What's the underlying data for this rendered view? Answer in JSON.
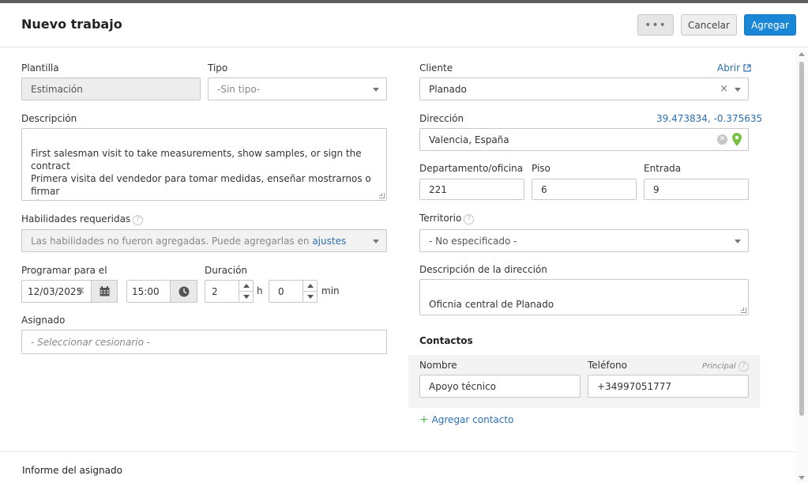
{
  "header": {
    "title": "Nuevo trabajo",
    "more_label": "•••",
    "cancel_label": "Cancelar",
    "add_label": "Agregar"
  },
  "left": {
    "plantilla_label": "Plantilla",
    "plantilla_value": "Estimación",
    "tipo_label": "Tipo",
    "tipo_placeholder": "-Sin tipo-",
    "descripcion_label": "Descripción",
    "descripcion_value": "First salesman visit to take measurements, show samples, or sign the contract\nPrimera visita del vendedor para tomar medidas, enseñar mostrarnos o firmar\nel contrato",
    "habilidades_label": "Habilidades requeridas",
    "habilidades_text": "Las habilidades no fueron agregadas. Puede agregarlas en",
    "habilidades_link": "ajustes",
    "programar_label": "Programar para el",
    "date_value": "12/03/2025",
    "time_value": "15:00",
    "duracion_label": "Duración",
    "hours_value": "2",
    "hours_unit": "h",
    "minutes_value": "0",
    "minutes_unit": "min",
    "asignado_label": "Asignado",
    "asignado_placeholder": "- Seleccionar cesionario -"
  },
  "right": {
    "cliente_label": "Cliente",
    "abrir_link": "Abrir",
    "cliente_value": "Planado",
    "direccion_label": "Dirección",
    "coords": "39.473834, -0.375635",
    "direccion_value": "Valencia, España",
    "departamento_label": "Departamento/oficina",
    "departamento_value": "221",
    "piso_label": "Piso",
    "piso_value": "6",
    "entrada_label": "Entrada",
    "entrada_value": "9",
    "territorio_label": "Territorio",
    "territorio_value": "- No especificado -",
    "desc_direccion_label": "Descripción de la dirección",
    "desc_direccion_value": "Oficnia central de Planado",
    "contactos_title": "Contactos",
    "nombre_label": "Nombre",
    "telefono_label": "Teléfono",
    "principal_label": "Principal",
    "contact_name": "Apoyo técnico",
    "contact_phone": "+34997051777",
    "agregar_contacto": "Agregar contacto"
  },
  "footer": {
    "informe_label": "Informe del asignado"
  },
  "colors": {
    "accent": "#1a87d6",
    "link": "#2a6fb0",
    "map_pin": "#7ac143"
  },
  "icons": [
    "calendar-icon",
    "clock-icon",
    "clear-icon",
    "external-link-icon",
    "map-pin-icon",
    "help-icon",
    "plus-icon"
  ]
}
